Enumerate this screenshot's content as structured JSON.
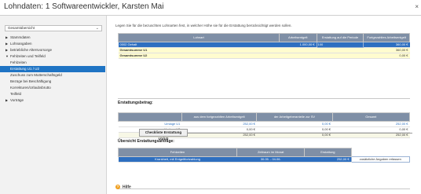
{
  "window": {
    "title": "Lohndaten: 1 Softwareentwickler, Karsten Mai",
    "close_label": "×"
  },
  "sidebar": {
    "dropdown_value": "Gesamtübersicht",
    "items": [
      {
        "label": "Stammdaten",
        "level": 1,
        "expanded": false
      },
      {
        "label": "Lohnangaben",
        "level": 1,
        "expanded": false
      },
      {
        "label": "betriebliche Altersvorsorge",
        "level": 1,
        "expanded": false
      },
      {
        "label": "Fehlzeiten und Teilfeld",
        "level": 1,
        "expanded": true
      },
      {
        "label": "Fehlzeiten",
        "level": 2
      },
      {
        "label": "Erstattung U1 / U2",
        "level": 2,
        "active": true
      },
      {
        "label": "Zuschuss zum Mutterschaftsgeld",
        "level": 2
      },
      {
        "label": "Bezüge bei Beschäftigung",
        "level": 2
      },
      {
        "label": "Korrekturen/Urlaubsbrutto",
        "level": 2
      },
      {
        "label": "Teilfeld",
        "level": 2
      },
      {
        "label": "Vorträge",
        "level": 1,
        "expanded": false
      }
    ]
  },
  "main": {
    "intro_text": "Legen Sie für die bezuschten Lohnarten fest, in welcher Höhe sie für die Erstattung berücksichtigt werden sollen.",
    "lohnarten_table": {
      "headers": [
        "Lohnart",
        "Arbeitsentgelt",
        "Erstattung auf die Periode",
        "Fortgezahltes Arbeitsentgelt"
      ],
      "rows": [
        {
          "lohnart": "0002 Gehalt",
          "arbeitsentgelt": "1.000,00 €",
          "erstattung": "100",
          "fortgezahlt": "360,00 €",
          "selected": true
        },
        {
          "lohnart": "Gesamtsumme U1",
          "arbeitsentgelt": "",
          "erstattung": "",
          "fortgezahlt": "360,00 €",
          "selected": false
        },
        {
          "lohnart": "Gesamtsumme U2",
          "arbeitsentgelt": "",
          "erstattung": "",
          "fortgezahlt": "0,00 €",
          "selected": false
        }
      ]
    },
    "erstattung_section_title": "Erstattungsbetrag:",
    "erstattung_table": {
      "headers": [
        "",
        "aus dem fortgezahlten Arbeitsentgelt",
        "der Arbeitgeberanteile zur SV",
        "Gesamt"
      ],
      "rows": [
        {
          "label": "Umlage U1",
          "fortgezahlt": "252,00 €",
          "ag_anteile": "0,00 €",
          "gesamt": "252,00 €"
        },
        {
          "label": "Umlage U2",
          "fortgezahlt": "0,00 €",
          "ag_anteile": "0,00 €",
          "gesamt": "0,00 €"
        },
        {
          "label": "Gesamtsumme",
          "fortgezahlt": "252,00 €",
          "ag_anteile": "0,00 €",
          "gesamt": "252,00 €"
        }
      ]
    },
    "checklist_button": "Checkliste Erstattung U1/U2",
    "antraege_section_title": "Übersicht Erstattungsanträge:",
    "antraege_table": {
      "headers": [
        "Fehlzeiten",
        "Zeitraum im Monat",
        "Erstattung"
      ],
      "rows": [
        {
          "fehlzeit": "Krankheit, mit Entgeltfortzahlung",
          "zeitraum": "30.05. - 04.06.",
          "erstattung": "252,00 €",
          "action": "zusätzliche Angaben erfassen"
        }
      ]
    },
    "help_label": "Hilfe",
    "help_icon_glyph": "?"
  }
}
